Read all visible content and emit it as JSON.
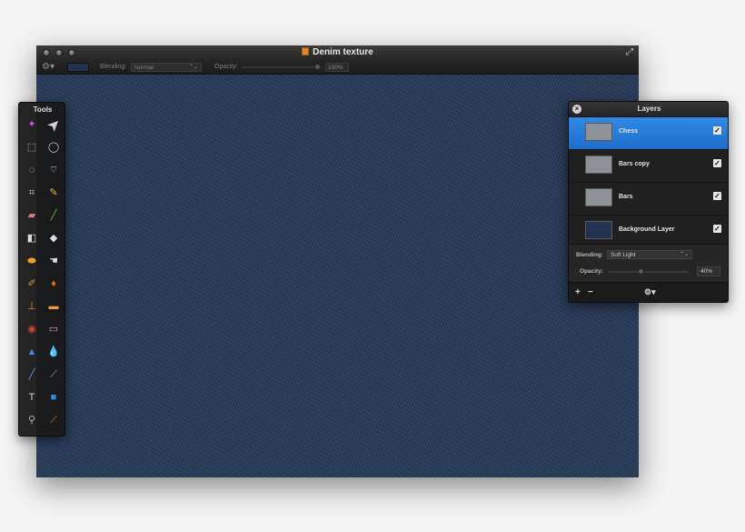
{
  "window": {
    "title": "Denim texture",
    "toolbar": {
      "blending_label": "Blending:",
      "blending_value": "Normal",
      "opacity_label": "Opacity:",
      "opacity_value": "100%"
    }
  },
  "tools_palette": {
    "title": "Tools",
    "tools": [
      "magic-wand-icon",
      "move-icon",
      "rect-select-icon",
      "ellipse-select-icon",
      "lasso-icon",
      "polygon-lasso-icon",
      "crop-icon",
      "pencil-icon",
      "eraser-icon",
      "brush-icon",
      "gradient-icon",
      "paint-bucket-icon",
      "sponge-icon",
      "smudge-icon",
      "burn-icon",
      "dodge-icon",
      "clone-stamp-icon",
      "heal-icon",
      "red-eye-icon",
      "bandaid-icon",
      "sharpen-icon",
      "blur-icon",
      "pen-icon",
      "vector-pen-icon",
      "text-icon",
      "shape-icon",
      "zoom-icon",
      "eyedropper-icon"
    ]
  },
  "layers_palette": {
    "title": "Layers",
    "layers": [
      {
        "name": "Chess",
        "visible": true,
        "selected": true
      },
      {
        "name": "Bars copy",
        "visible": true,
        "selected": false
      },
      {
        "name": "Bars",
        "visible": true,
        "selected": false
      },
      {
        "name": "Background Layer",
        "visible": true,
        "selected": false
      }
    ],
    "blending_label": "Blending:",
    "blending_value": "Soft Light",
    "opacity_label": "Opacity:",
    "opacity_value": "40%",
    "opacity_level": 0.4
  },
  "colors": {
    "selection": "#2f8ae6",
    "canvas": "#273a57"
  }
}
